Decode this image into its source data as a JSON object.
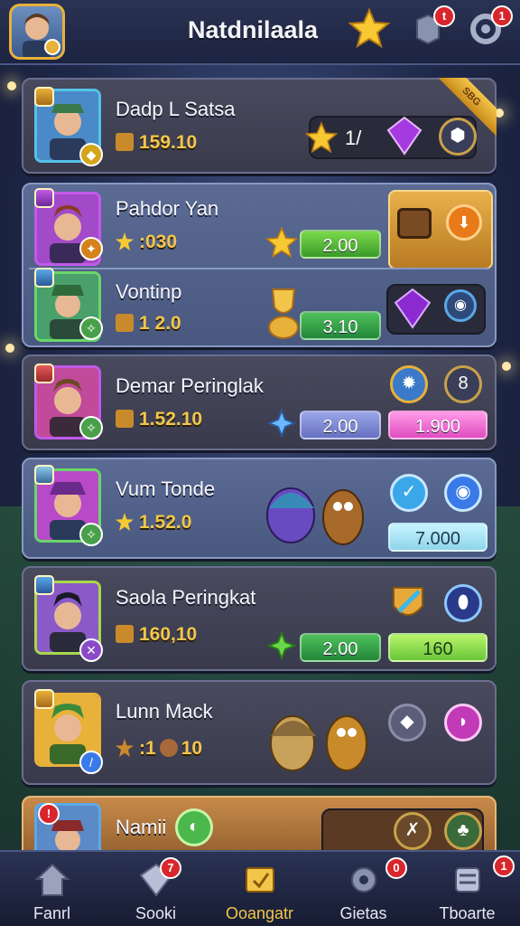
{
  "header": {
    "title": "Natdnilaala",
    "notifications_badge": "t",
    "settings_badge": "1"
  },
  "rows": [
    {
      "name": "Dadp L Satsa",
      "score": "159.10",
      "stat": "1/",
      "ribbon": "SBG"
    },
    {
      "name": "Pahdor Yan",
      "score": ":030",
      "value": "2.00"
    },
    {
      "name": "Vontinp",
      "score": "1 2.0",
      "value": "3.10"
    },
    {
      "name": "Demar Peringlak",
      "score": "1.52.10",
      "value1": "2.00",
      "value2": "1.900"
    },
    {
      "name": "Vum Tonde",
      "score": "1.52.0",
      "value": "7.000"
    },
    {
      "name": "Saola Peringkat",
      "score": "160,10",
      "value1": "2.00",
      "value2": "160"
    },
    {
      "name": "Lunn Mack",
      "score": ":1",
      "score_suffix": "10"
    },
    {
      "name": "Namii"
    }
  ],
  "nav": {
    "items": [
      {
        "label": "Fanrl",
        "icon": "home-icon"
      },
      {
        "label": "Sooki",
        "icon": "gem-icon",
        "badge": "7"
      },
      {
        "label": "Ooangatr",
        "icon": "trophy-icon"
      },
      {
        "label": "Gietas",
        "icon": "gear-icon",
        "badge": "0"
      },
      {
        "label": "Tboarte",
        "icon": "list-icon",
        "badge": "1"
      }
    ]
  },
  "colors": {
    "gold": "#f2c64a",
    "accent_blue": "#55c2e8",
    "badge_red": "#d8262c"
  }
}
